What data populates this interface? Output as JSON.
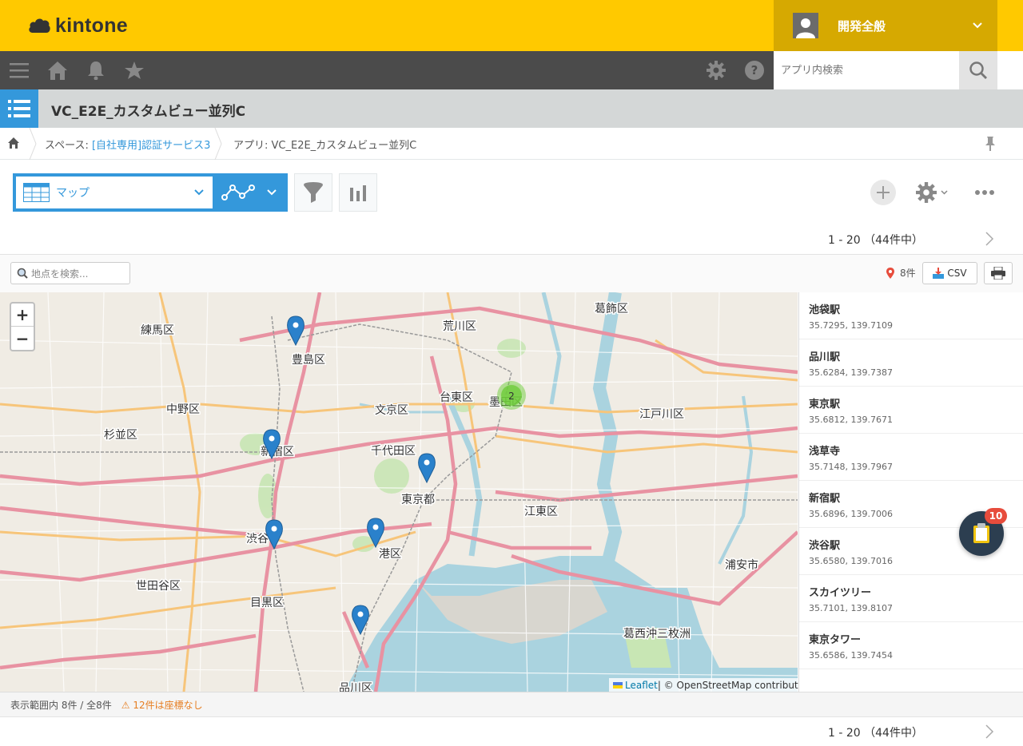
{
  "header": {
    "logo_text": "kintone",
    "user_name": "開発全般"
  },
  "nav": {
    "search_placeholder": "アプリ内検索"
  },
  "app": {
    "title": "VC_E2E_カスタムビュー並列C"
  },
  "breadcrumb": {
    "space_prefix": "スペース: ",
    "space_link": "[自社専用]認証サービス3",
    "app_label": "アプリ: VC_E2E_カスタムビュー並列C"
  },
  "toolbar": {
    "view_name": "マップ"
  },
  "pager": {
    "top": "1 - 20 （44件中）",
    "bottom": "1 - 20 （44件中）"
  },
  "map_panel": {
    "search_placeholder": "地点を検索...",
    "marker_count": "8件",
    "csv_label": "CSV",
    "zoom_in": "+",
    "zoom_out": "−",
    "attribution_link": "Leaflet",
    "attribution_text": " | © OpenStreetMap contributors",
    "cluster_count": "2",
    "labels": {
      "nerima": "練馬区",
      "toshima": "豊島区",
      "arakawa": "荒川区",
      "katsushika": "葛飾区",
      "nakano": "中野区",
      "bunkyo": "文京区",
      "taito": "台東区",
      "suginami": "杉並区",
      "shinjuku": "新宿区",
      "chiyoda": "千代田区",
      "edogawa": "江戸川区",
      "tokyo": "東京都",
      "koto": "江東区",
      "shibuya": "渋谷",
      "minato": "港区",
      "setagaya": "世田谷区",
      "meguro": "目黒区",
      "urayasu": "浦安市",
      "sumida": "墨田区",
      "shinagawa": "品川区",
      "kasai": "葛西沖三枚洲"
    }
  },
  "locations": [
    {
      "name": "池袋駅",
      "coord": "35.7295, 139.7109"
    },
    {
      "name": "品川駅",
      "coord": "35.6284, 139.7387"
    },
    {
      "name": "東京駅",
      "coord": "35.6812, 139.7671"
    },
    {
      "name": "浅草寺",
      "coord": "35.7148, 139.7967"
    },
    {
      "name": "新宿駅",
      "coord": "35.6896, 139.7006"
    },
    {
      "name": "渋谷駅",
      "coord": "35.6580, 139.7016"
    },
    {
      "name": "スカイツリー",
      "coord": "35.7101, 139.8107"
    },
    {
      "name": "東京タワー",
      "coord": "35.6586, 139.7454"
    }
  ],
  "footer": {
    "range_text": "表示範囲内 8件 / 全8件",
    "warning_text": "⚠ 12件は座標なし"
  },
  "fab": {
    "badge": "10"
  },
  "colors": {
    "brand_yellow": "#ffc900",
    "nav_dark": "#4b4b4b",
    "accent_blue": "#3498db"
  }
}
